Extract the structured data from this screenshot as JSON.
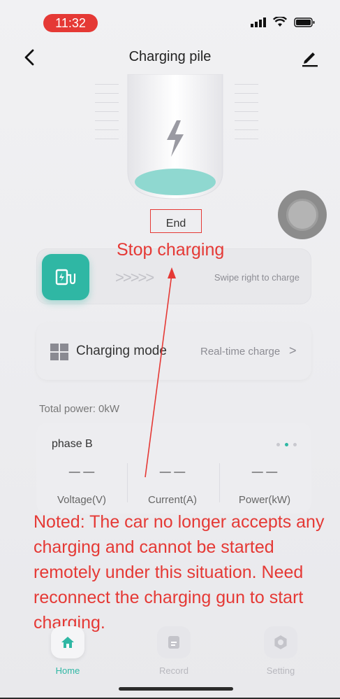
{
  "status_bar": {
    "time": "11:32"
  },
  "header": {
    "title": "Charging pile"
  },
  "charger": {
    "status_label": "End"
  },
  "annotations": {
    "stop_label": "Stop charging",
    "note": "Noted: The car no longer accepts any charging and cannot be started remotely under this situation. Need reconnect the charging gun to start charging."
  },
  "swipe": {
    "chevrons": ">>>>>",
    "hint": "Swipe right to charge"
  },
  "mode": {
    "label": "Charging mode",
    "value": "Real-time charge",
    "chevron": ">"
  },
  "total_power": "Total power:  0kW",
  "phase": {
    "title": "phase B",
    "metrics": [
      {
        "value": "— —",
        "label": "Voltage(V)"
      },
      {
        "value": "— —",
        "label": "Current(A)"
      },
      {
        "value": "— —",
        "label": "Power(kW)"
      }
    ]
  },
  "nav": {
    "items": [
      {
        "label": "Home",
        "icon": "home-icon",
        "active": true
      },
      {
        "label": "Record",
        "icon": "record-icon",
        "active": false
      },
      {
        "label": "Setting",
        "icon": "setting-icon",
        "active": false
      }
    ]
  },
  "colors": {
    "accent": "#2fb7a4",
    "annotation": "#e53935"
  }
}
